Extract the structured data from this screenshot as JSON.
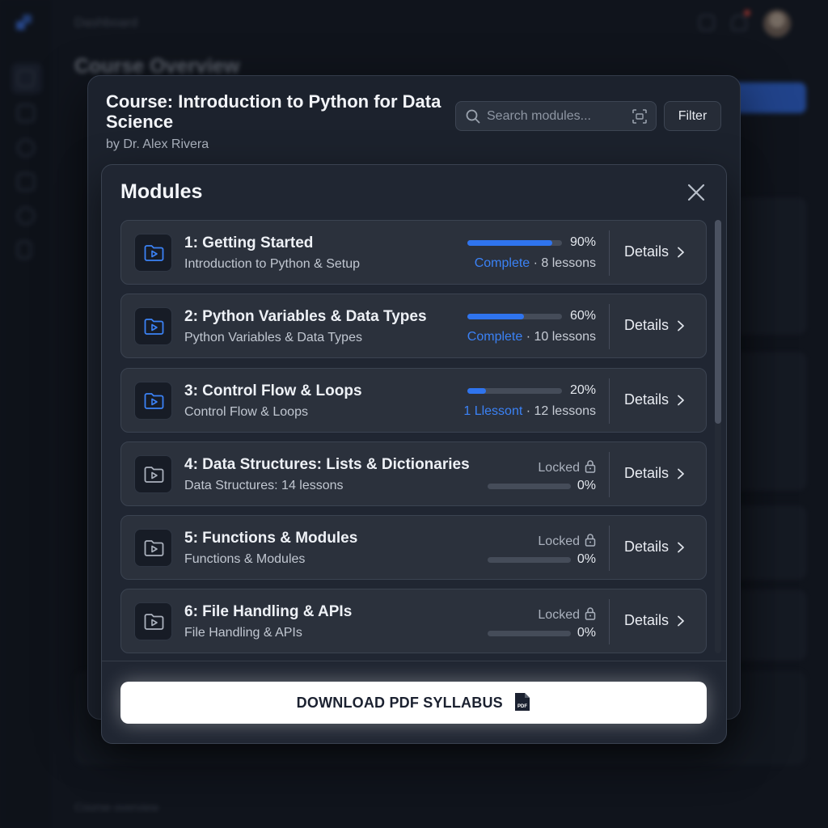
{
  "background": {
    "breadcrumb": "Dashboard",
    "page_title": "Course Overview",
    "footer_text": "Course overview"
  },
  "course": {
    "title": "Course: Introduction to Python for Data Science",
    "author": "by Dr. Alex Rivera"
  },
  "search": {
    "placeholder": "Search modules..."
  },
  "filter_label": "Filter",
  "modal": {
    "title": "Modules",
    "download_label": "DOWNLOAD PDF SYLLABUS",
    "pdf_badge": "PDF"
  },
  "colors": {
    "accent": "#2f74ee",
    "status_blue": "#3b82f6",
    "modal_bg": "#202632"
  },
  "modules": [
    {
      "title": "1: Getting Started",
      "subtitle": "Introduction to Python & Setup",
      "progress": 90,
      "percent_label": "90%",
      "status": "Complete",
      "lessons": " · 8 lessons",
      "locked": false,
      "locked_label": "",
      "details": "Details"
    },
    {
      "title": "2: Python Variables & Data Types",
      "subtitle": "Python Variables & Data Types",
      "progress": 60,
      "percent_label": "60%",
      "status": "Complete",
      "lessons": " · 10 lessons",
      "locked": false,
      "locked_label": "",
      "details": "Details"
    },
    {
      "title": "3: Control Flow & Loops",
      "subtitle": "Control Flow & Loops",
      "progress": 20,
      "percent_label": "20%",
      "status": "1 Llessont",
      "lessons": " · 12 lessons",
      "locked": false,
      "locked_label": "",
      "details": "Details"
    },
    {
      "title": "4: Data Structures: Lists & Dictionaries",
      "subtitle": "Data Structures: 14 lessons",
      "progress": 0,
      "percent_label": "0%",
      "status": "",
      "lessons": "",
      "locked": true,
      "locked_label": "Locked",
      "details": "Details"
    },
    {
      "title": "5: Functions & Modules",
      "subtitle": "Functions & Modules",
      "progress": 0,
      "percent_label": "0%",
      "status": "",
      "lessons": "",
      "locked": true,
      "locked_label": "Locked",
      "details": "Details"
    },
    {
      "title": "6: File Handling & APIs",
      "subtitle": "File Handling & APIs",
      "progress": 0,
      "percent_label": "0%",
      "status": "",
      "lessons": "",
      "locked": true,
      "locked_label": "Locked",
      "details": "Details"
    }
  ]
}
